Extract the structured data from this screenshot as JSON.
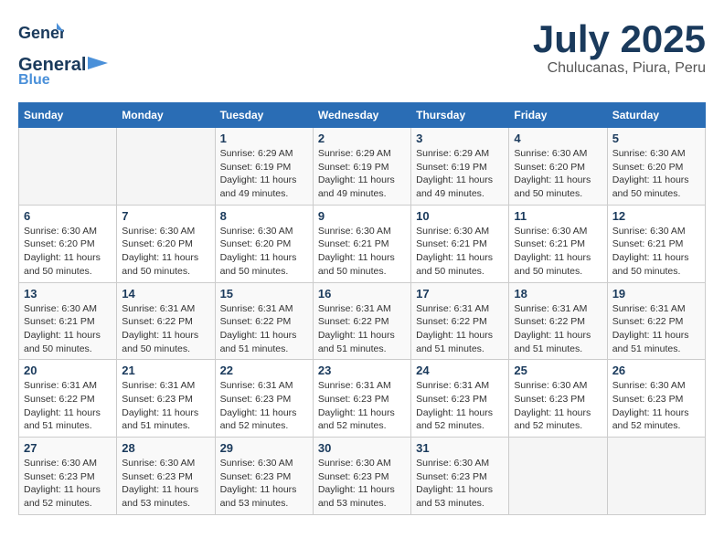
{
  "header": {
    "logo_general": "General",
    "logo_blue": "Blue",
    "month_title": "July 2025",
    "subtitle": "Chulucanas, Piura, Peru"
  },
  "weekdays": [
    "Sunday",
    "Monday",
    "Tuesday",
    "Wednesday",
    "Thursday",
    "Friday",
    "Saturday"
  ],
  "weeks": [
    [
      {
        "day": "",
        "info": ""
      },
      {
        "day": "",
        "info": ""
      },
      {
        "day": "1",
        "info": "Sunrise: 6:29 AM\nSunset: 6:19 PM\nDaylight: 11 hours and 49 minutes."
      },
      {
        "day": "2",
        "info": "Sunrise: 6:29 AM\nSunset: 6:19 PM\nDaylight: 11 hours and 49 minutes."
      },
      {
        "day": "3",
        "info": "Sunrise: 6:29 AM\nSunset: 6:19 PM\nDaylight: 11 hours and 49 minutes."
      },
      {
        "day": "4",
        "info": "Sunrise: 6:30 AM\nSunset: 6:20 PM\nDaylight: 11 hours and 50 minutes."
      },
      {
        "day": "5",
        "info": "Sunrise: 6:30 AM\nSunset: 6:20 PM\nDaylight: 11 hours and 50 minutes."
      }
    ],
    [
      {
        "day": "6",
        "info": "Sunrise: 6:30 AM\nSunset: 6:20 PM\nDaylight: 11 hours and 50 minutes."
      },
      {
        "day": "7",
        "info": "Sunrise: 6:30 AM\nSunset: 6:20 PM\nDaylight: 11 hours and 50 minutes."
      },
      {
        "day": "8",
        "info": "Sunrise: 6:30 AM\nSunset: 6:20 PM\nDaylight: 11 hours and 50 minutes."
      },
      {
        "day": "9",
        "info": "Sunrise: 6:30 AM\nSunset: 6:21 PM\nDaylight: 11 hours and 50 minutes."
      },
      {
        "day": "10",
        "info": "Sunrise: 6:30 AM\nSunset: 6:21 PM\nDaylight: 11 hours and 50 minutes."
      },
      {
        "day": "11",
        "info": "Sunrise: 6:30 AM\nSunset: 6:21 PM\nDaylight: 11 hours and 50 minutes."
      },
      {
        "day": "12",
        "info": "Sunrise: 6:30 AM\nSunset: 6:21 PM\nDaylight: 11 hours and 50 minutes."
      }
    ],
    [
      {
        "day": "13",
        "info": "Sunrise: 6:30 AM\nSunset: 6:21 PM\nDaylight: 11 hours and 50 minutes."
      },
      {
        "day": "14",
        "info": "Sunrise: 6:31 AM\nSunset: 6:22 PM\nDaylight: 11 hours and 50 minutes."
      },
      {
        "day": "15",
        "info": "Sunrise: 6:31 AM\nSunset: 6:22 PM\nDaylight: 11 hours and 51 minutes."
      },
      {
        "day": "16",
        "info": "Sunrise: 6:31 AM\nSunset: 6:22 PM\nDaylight: 11 hours and 51 minutes."
      },
      {
        "day": "17",
        "info": "Sunrise: 6:31 AM\nSunset: 6:22 PM\nDaylight: 11 hours and 51 minutes."
      },
      {
        "day": "18",
        "info": "Sunrise: 6:31 AM\nSunset: 6:22 PM\nDaylight: 11 hours and 51 minutes."
      },
      {
        "day": "19",
        "info": "Sunrise: 6:31 AM\nSunset: 6:22 PM\nDaylight: 11 hours and 51 minutes."
      }
    ],
    [
      {
        "day": "20",
        "info": "Sunrise: 6:31 AM\nSunset: 6:22 PM\nDaylight: 11 hours and 51 minutes."
      },
      {
        "day": "21",
        "info": "Sunrise: 6:31 AM\nSunset: 6:23 PM\nDaylight: 11 hours and 51 minutes."
      },
      {
        "day": "22",
        "info": "Sunrise: 6:31 AM\nSunset: 6:23 PM\nDaylight: 11 hours and 52 minutes."
      },
      {
        "day": "23",
        "info": "Sunrise: 6:31 AM\nSunset: 6:23 PM\nDaylight: 11 hours and 52 minutes."
      },
      {
        "day": "24",
        "info": "Sunrise: 6:31 AM\nSunset: 6:23 PM\nDaylight: 11 hours and 52 minutes."
      },
      {
        "day": "25",
        "info": "Sunrise: 6:30 AM\nSunset: 6:23 PM\nDaylight: 11 hours and 52 minutes."
      },
      {
        "day": "26",
        "info": "Sunrise: 6:30 AM\nSunset: 6:23 PM\nDaylight: 11 hours and 52 minutes."
      }
    ],
    [
      {
        "day": "27",
        "info": "Sunrise: 6:30 AM\nSunset: 6:23 PM\nDaylight: 11 hours and 52 minutes."
      },
      {
        "day": "28",
        "info": "Sunrise: 6:30 AM\nSunset: 6:23 PM\nDaylight: 11 hours and 53 minutes."
      },
      {
        "day": "29",
        "info": "Sunrise: 6:30 AM\nSunset: 6:23 PM\nDaylight: 11 hours and 53 minutes."
      },
      {
        "day": "30",
        "info": "Sunrise: 6:30 AM\nSunset: 6:23 PM\nDaylight: 11 hours and 53 minutes."
      },
      {
        "day": "31",
        "info": "Sunrise: 6:30 AM\nSunset: 6:23 PM\nDaylight: 11 hours and 53 minutes."
      },
      {
        "day": "",
        "info": ""
      },
      {
        "day": "",
        "info": ""
      }
    ]
  ]
}
